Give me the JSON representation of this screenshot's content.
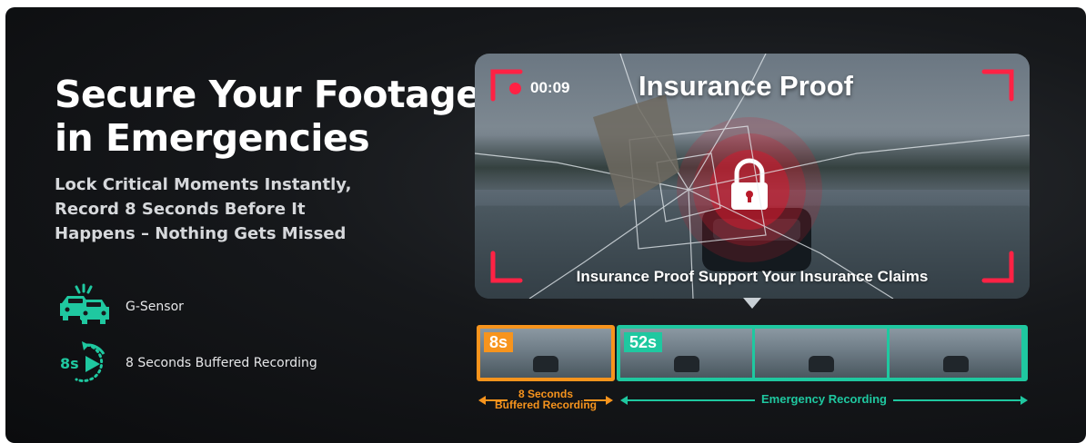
{
  "hero": {
    "headline_line1": "Secure Your Footage",
    "headline_line2": "in Emergencies",
    "subhead_line1": "Lock Critical Moments Instantly,",
    "subhead_line2": "Record 8 Seconds Before It",
    "subhead_line3": "Happens – Nothing Gets Missed"
  },
  "features": [
    {
      "icon": "collision-cars-icon",
      "label": "G-Sensor"
    },
    {
      "icon": "8s-replay-icon",
      "icon_text": "8s",
      "label": "8 Seconds  Buffered Recording"
    }
  ],
  "video": {
    "timestamp": "00:09",
    "title": "Insurance Proof",
    "caption": "Insurance Proof Support Your Insurance Claims",
    "lock_icon": "padlock-icon"
  },
  "timeline": {
    "buffer_badge": "8s",
    "emergency_badge": "52s",
    "buffer_label_line1": "8 Seconds",
    "buffer_label_line2": "Buffered Recording",
    "emergency_label": "Emergency Recording"
  },
  "colors": {
    "accent_red": "#ff2244",
    "buffer_orange": "#f7941d",
    "emergency_teal": "#1fc8a0",
    "background": "#0b0c0e"
  }
}
